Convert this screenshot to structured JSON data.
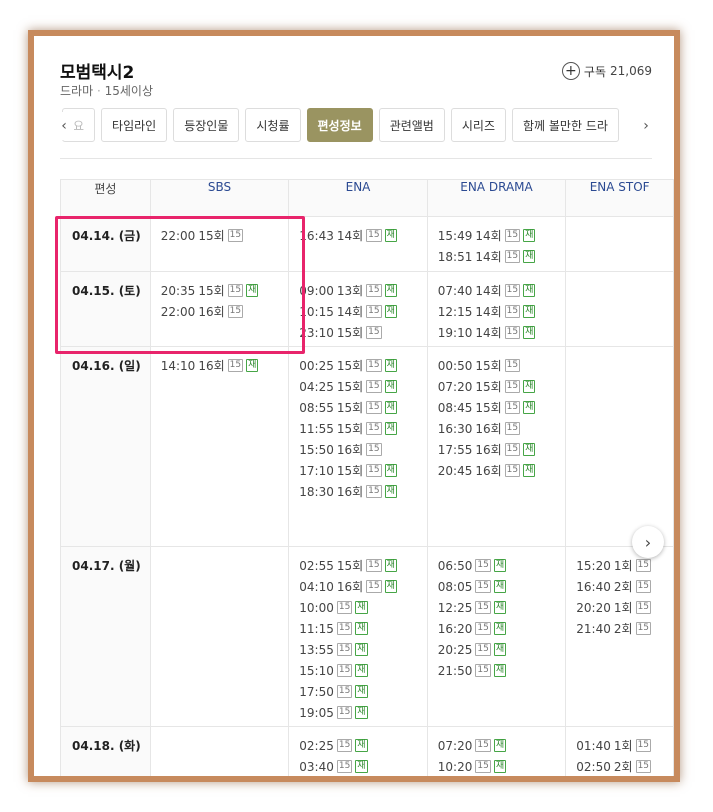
{
  "show": {
    "title": "모범택시2",
    "genre": "드라마",
    "rating": "15세이상"
  },
  "subscribe": {
    "label": "구독",
    "count": "21,069"
  },
  "tabs": [
    "요",
    "타임라인",
    "등장인물",
    "시청률",
    "편성정보",
    "관련앨범",
    "시리즈",
    "함께 볼만한 드라"
  ],
  "active_tab": "편성정보",
  "nav": {
    "prev": "‹",
    "next": "›"
  },
  "table": {
    "columns": [
      "편성",
      "SBS",
      "ENA",
      "ENA DRAMA",
      "ENA STOF"
    ],
    "rows": [
      {
        "date": "04.14. (금)",
        "sbs": [
          [
            "22:00",
            "15회",
            "15",
            ""
          ]
        ],
        "ena": [
          [
            "16:43",
            "14회",
            "15",
            "재"
          ]
        ],
        "drama": [
          [
            "15:49",
            "14회",
            "15",
            "재"
          ],
          [
            "18:51",
            "14회",
            "15",
            "재"
          ]
        ],
        "story": []
      },
      {
        "date": "04.15. (토)",
        "sbs": [
          [
            "20:35",
            "15회",
            "15",
            "재"
          ],
          [
            "22:00",
            "16회",
            "15",
            ""
          ]
        ],
        "ena": [
          [
            "09:00",
            "13회",
            "15",
            "재"
          ],
          [
            "10:15",
            "14회",
            "15",
            "재"
          ],
          [
            "23:10",
            "15회",
            "15",
            ""
          ]
        ],
        "drama": [
          [
            "07:40",
            "14회",
            "15",
            "재"
          ],
          [
            "12:15",
            "14회",
            "15",
            "재"
          ],
          [
            "19:10",
            "14회",
            "15",
            "재"
          ]
        ],
        "story": []
      },
      {
        "date": "04.16. (일)",
        "sbs": [
          [
            "14:10",
            "16회",
            "15",
            "재"
          ]
        ],
        "ena": [
          [
            "00:25",
            "15회",
            "15",
            "재"
          ],
          [
            "04:25",
            "15회",
            "15",
            "재"
          ],
          [
            "08:55",
            "15회",
            "15",
            "재"
          ],
          [
            "11:55",
            "15회",
            "15",
            "재"
          ],
          [
            "15:50",
            "16회",
            "15",
            ""
          ],
          [
            "17:10",
            "15회",
            "15",
            "재"
          ],
          [
            "18:30",
            "16회",
            "15",
            "재"
          ]
        ],
        "drama": [
          [
            "00:50",
            "15회",
            "15",
            ""
          ],
          [
            "07:20",
            "15회",
            "15",
            "재"
          ],
          [
            "08:45",
            "15회",
            "15",
            "재"
          ],
          [
            "16:30",
            "16회",
            "15",
            ""
          ],
          [
            "17:55",
            "16회",
            "15",
            "재"
          ],
          [
            "20:45",
            "16회",
            "15",
            "재"
          ]
        ],
        "story": []
      },
      {
        "date": "04.17. (월)",
        "sbs": [],
        "ena": [
          [
            "02:55",
            "15회",
            "15",
            "재"
          ],
          [
            "04:10",
            "16회",
            "15",
            "재"
          ],
          [
            "10:00",
            "",
            "15",
            "재"
          ],
          [
            "11:15",
            "",
            "15",
            "재"
          ],
          [
            "13:55",
            "",
            "15",
            "재"
          ],
          [
            "15:10",
            "",
            "15",
            "재"
          ],
          [
            "17:50",
            "",
            "15",
            "재"
          ],
          [
            "19:05",
            "",
            "15",
            "재"
          ]
        ],
        "drama": [
          [
            "06:50",
            "",
            "15",
            "재"
          ],
          [
            "08:05",
            "",
            "15",
            "재"
          ],
          [
            "12:25",
            "",
            "15",
            "재"
          ],
          [
            "16:20",
            "",
            "15",
            "재"
          ],
          [
            "20:25",
            "",
            "15",
            "재"
          ],
          [
            "21:50",
            "",
            "15",
            "재"
          ]
        ],
        "story": [
          [
            "15:20",
            "1회",
            "15",
            ""
          ],
          [
            "16:40",
            "2회",
            "15",
            ""
          ],
          [
            "20:20",
            "1회",
            "15",
            ""
          ],
          [
            "21:40",
            "2회",
            "15",
            ""
          ]
        ]
      },
      {
        "date": "04.18. (화)",
        "sbs": [],
        "ena": [
          [
            "02:25",
            "",
            "15",
            "재"
          ],
          [
            "03:40",
            "",
            "15",
            "재"
          ]
        ],
        "drama": [
          [
            "07:20",
            "",
            "15",
            "재"
          ],
          [
            "10:20",
            "",
            "15",
            "재"
          ]
        ],
        "story": [
          [
            "01:40",
            "1회",
            "15",
            ""
          ],
          [
            "02:50",
            "2회",
            "15",
            ""
          ]
        ]
      }
    ]
  }
}
